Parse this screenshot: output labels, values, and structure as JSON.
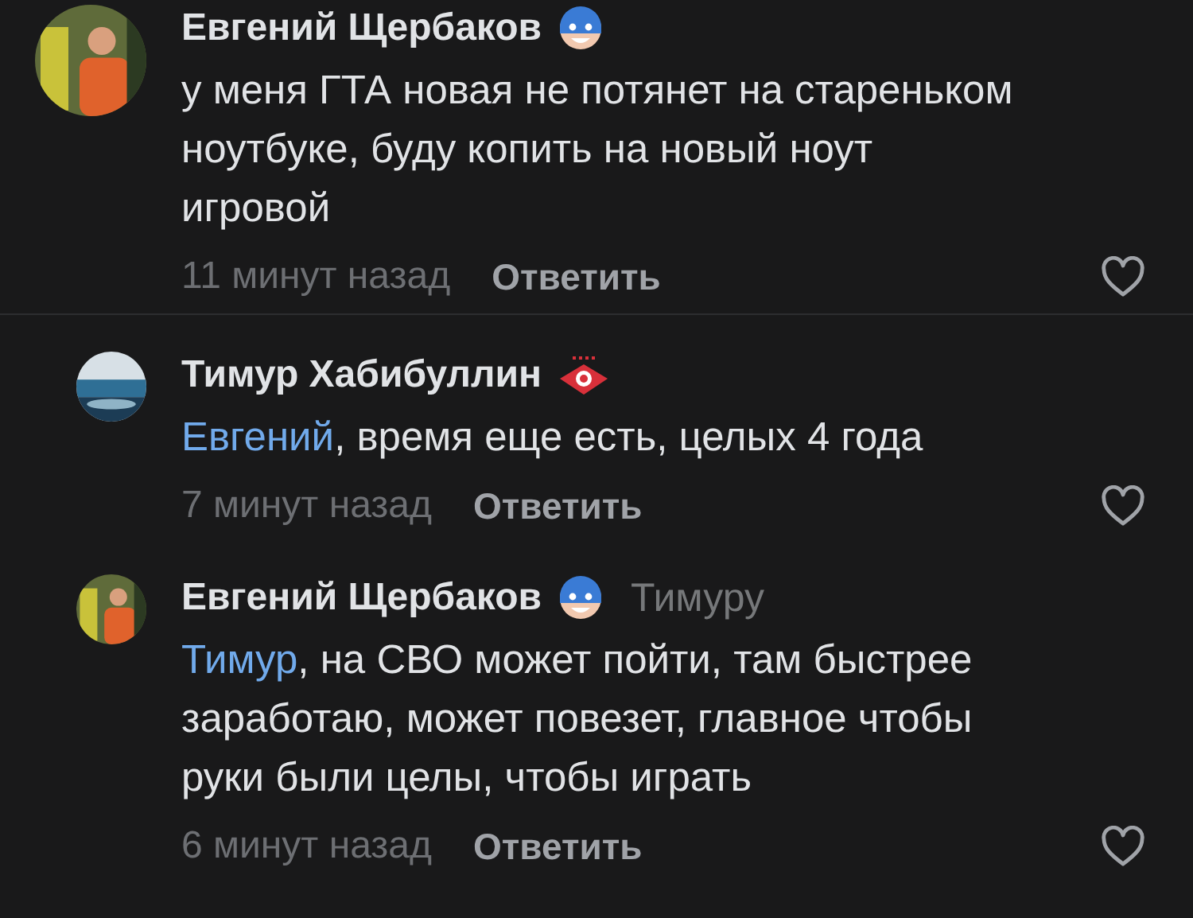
{
  "comments": [
    {
      "kind": "root",
      "author": "Евгений Щербаков",
      "badge": {
        "kind": "mask"
      },
      "lines": [
        "у меня ГТА новая не потянет на стареньком",
        "ноутбуке, буду копить на новый ноут",
        "игровой"
      ],
      "time": "11 минут назад",
      "reply_button": "Ответить",
      "liked": false
    },
    {
      "kind": "reply",
      "author": "Тимур Хабибуллин",
      "badge": {
        "kind": "diamond"
      },
      "mention": "Евгений",
      "lines": [
        ", время еще есть, целых 4 года"
      ],
      "time": "7 минут назад",
      "reply_button": "Ответить",
      "liked": false
    },
    {
      "kind": "reply",
      "author": "Евгений Щербаков",
      "badge": {
        "kind": "mask"
      },
      "reply_to": "Тимуру",
      "mention": "Тимур",
      "lines": [
        ", на СВО может пойти, там быстрее",
        "заработаю, может повезет, главное чтобы",
        "руки были целы, чтобы играть"
      ],
      "time": "6 минут назад",
      "reply_button": "Ответить",
      "liked": false
    }
  ]
}
